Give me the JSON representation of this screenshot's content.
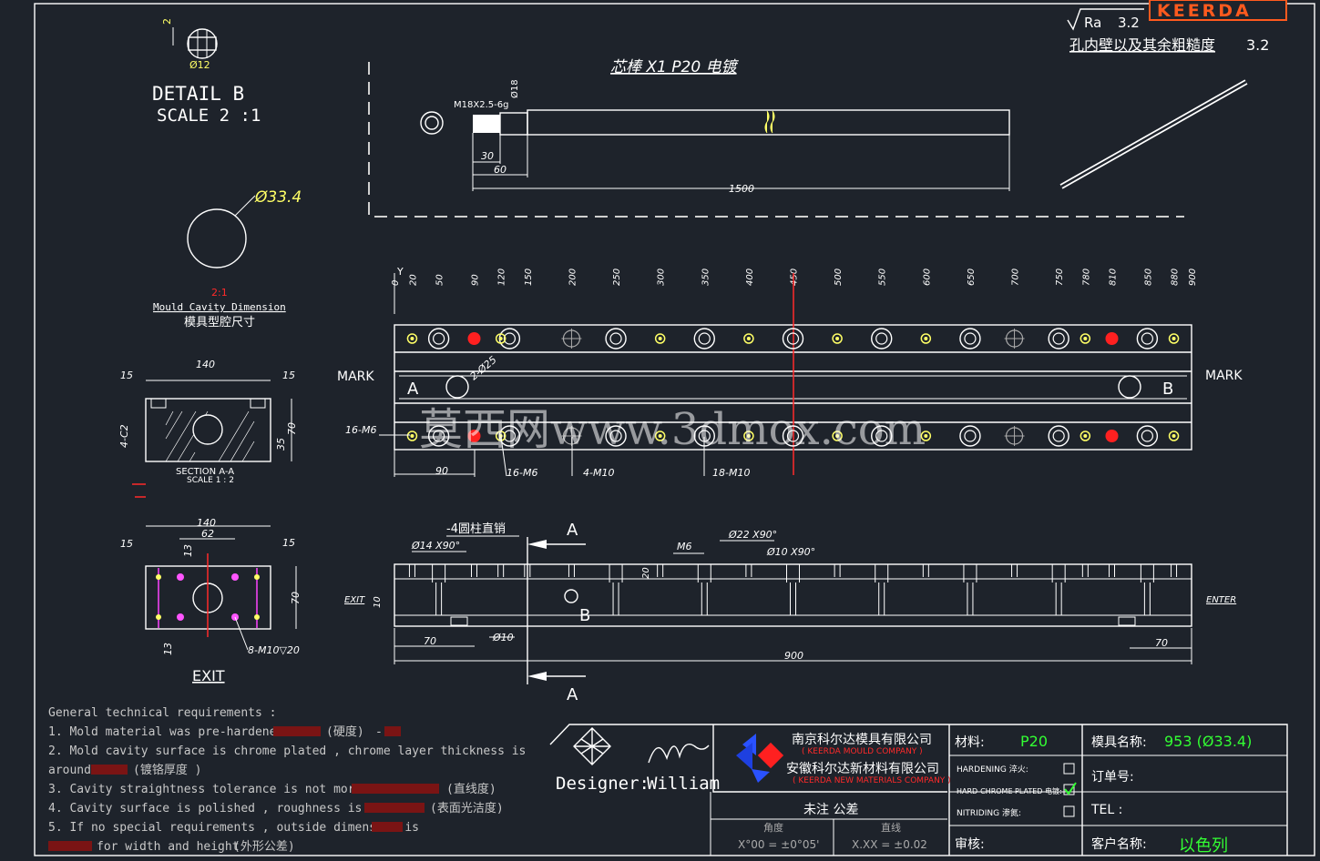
{
  "header": {
    "roughness_symbol": "Ra",
    "roughness_value": "3.2",
    "roughness_note": "孔内壁以及其余粗糙度",
    "roughness_note_value": "3.2",
    "logo_text": "KEERDA"
  },
  "detail_b": {
    "dim_h": "2",
    "dim_dia": "Ø12",
    "title": "DETAIL B",
    "scale": "SCALE 2 :1"
  },
  "mandrel": {
    "title": "芯棒 X1   P20  电镀",
    "thread": "M18X2.5-6g",
    "dia": "Ø18",
    "dim_30": "30",
    "dim_60": "60",
    "dim_1500": "1500"
  },
  "cavity": {
    "dia": "Ø33.4",
    "scale": "2:1",
    "title_en": "Mould Cavity Dimension",
    "title_cn": "模具型腔尺寸"
  },
  "top_view": {
    "ruler": [
      "0",
      "20",
      "50",
      "90",
      "120",
      "150",
      "200",
      "250",
      "300",
      "350",
      "400",
      "450",
      "500",
      "550",
      "600",
      "650",
      "700",
      "750",
      "780",
      "810",
      "850",
      "880",
      "900"
    ],
    "y_label": "Y",
    "mark_left": "MARK",
    "mark_right": "MARK",
    "label_a": "A",
    "label_b": "B",
    "holes_note": "2-Ø25",
    "m6_note": "16-M6",
    "dim_90": "90",
    "m6_lower": "16-M6",
    "m10_4": "4-M10",
    "m10_18": "18-M10"
  },
  "section_aa": {
    "dim_140": "140",
    "dim_15l": "15",
    "dim_15r": "15",
    "dim_70": "70",
    "dim_35": "35",
    "dim_4c2": "4-C2",
    "title": "SECTION A-A",
    "scale": "SCALE 1 : 2"
  },
  "exit_view": {
    "dim_140": "140",
    "dim_62": "62",
    "dim_15l": "15",
    "dim_15r": "15",
    "dim_13t": "13",
    "dim_70": "70",
    "dim_13b": "13",
    "note": "8-M10▽20",
    "title": "EXIT"
  },
  "side_view": {
    "pin_note": "-4圆柱直销",
    "d14": "Ø14  X90°",
    "m6": "M6",
    "d22": "Ø22  X90°",
    "d10a": "Ø10  X90°",
    "dim_20": "20",
    "dim_10": "10",
    "dim_70l": "70",
    "d10b": "Ø10",
    "dim_900": "900",
    "dim_70r": "70",
    "exit_left": "EXIT",
    "exit_right": "ENTER",
    "a_top": "A",
    "a_bot": "A",
    "b": "B"
  },
  "watermark": "莫西网www.3dmox.com",
  "requirements": {
    "title": "General technical requirements :",
    "lines": [
      "1. Mold material was pre-hardened to",
      "2. Mold cavity surface is chrome plated , chrome   layer thickness is",
      "around",
      "3. Cavity straightness tolerance is not more than",
      "4. Cavity surface is polished , roughness is better",
      "5. If no special requirements , outside dimension is",
      "for width and height"
    ],
    "cn": [
      "(硬度)",
      "(镀铬厚度 )",
      "(直线度)",
      "(表面光洁度)",
      "(外形公差)"
    ],
    "dash": "-"
  },
  "title_block": {
    "designer_label": "Designer:",
    "designer_name": "William",
    "company1": "南京科尔达模具有限公司",
    "company1_en": "( KEERDA MOULD COMPANY )",
    "company2": "安徽科尔达新材料有限公司",
    "company2_en": "( KEERDA NEW MATERIALS COMPANY )",
    "tol_title": "未注  公差",
    "angle_label": "角度",
    "angle_value": "X°00 = ±0°05'",
    "linear_label": "直线",
    "linear_value": "X.XX = ±0.02",
    "material_label": "材料:",
    "material_value": "P20",
    "hardening": "HARDENING 淬火:",
    "chrome": "HARD-CHROME PLATED 电镀:",
    "nitriding": "NITRIDING 渗氮:",
    "review_label": "审核:",
    "mold_name_label": "模具名称:",
    "mold_name_value": "953 (Ø33.4)",
    "order_label": "订单号:",
    "tel_label": "TEL   :",
    "customer_label": "客户名称:",
    "customer_value": "以色列"
  },
  "colors": {
    "background": "#1e232b",
    "line": "#ffffff",
    "accent_red": "#ff2a2a",
    "accent_yellow": "#ffff66",
    "accent_green": "#33ff33",
    "logo": "#ff5a1e"
  }
}
